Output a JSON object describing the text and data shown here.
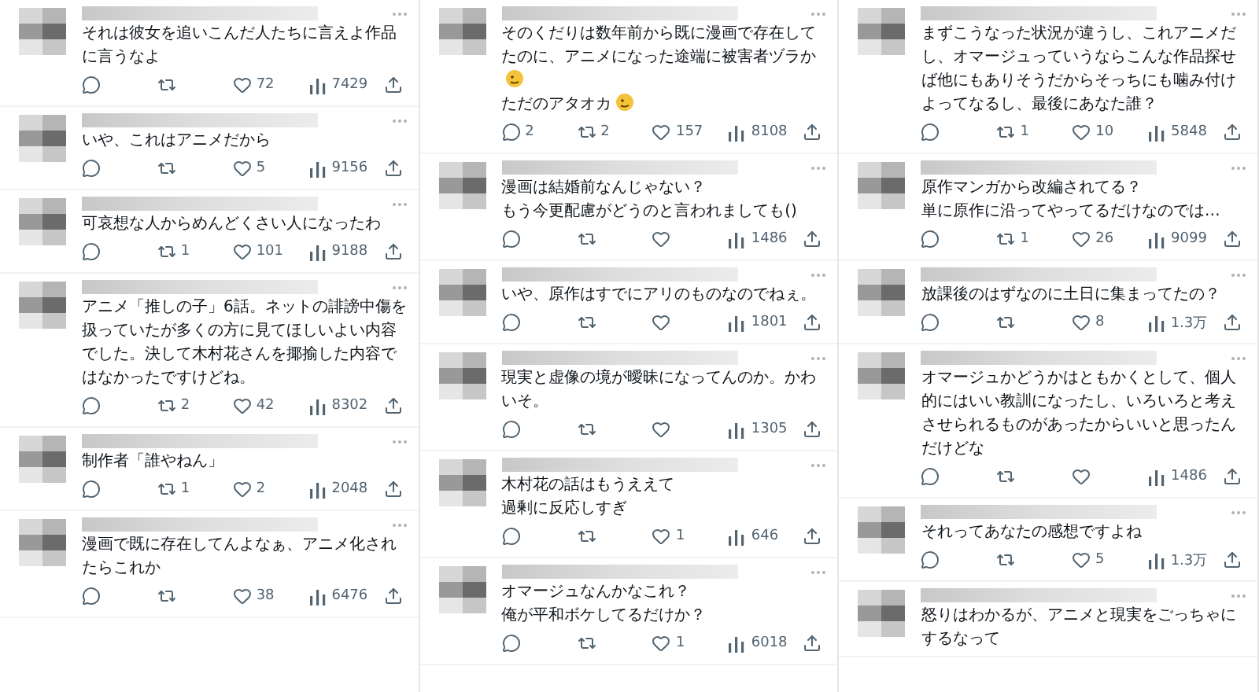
{
  "columns": [
    {
      "replies": [
        {
          "paragraphs": [
            {
              "kind": "plain",
              "text": "それは彼女を追いこんだ人たちに言えよ作品に言うなよ"
            }
          ],
          "stats": {
            "likes": "72",
            "views": "7429"
          }
        },
        {
          "paragraphs": [
            {
              "kind": "plain",
              "text": "いや、これはアニメだから"
            }
          ],
          "stats": {
            "likes": "5",
            "views": "9156"
          }
        },
        {
          "paragraphs": [
            {
              "kind": "plain",
              "text": "可哀想な人からめんどくさい人になったわ"
            }
          ],
          "stats": {
            "reposts": "1",
            "likes": "101",
            "views": "9188"
          }
        },
        {
          "paragraphs": [
            {
              "kind": "plain",
              "text": "アニメ「推しの子」6話。ネットの誹謗中傷を扱っていたが多くの方に見てほしいよい内容でした。決して木村花さんを揶揄した内容ではなかったですけどね。"
            }
          ],
          "stats": {
            "reposts": "2",
            "likes": "42",
            "views": "8302"
          }
        },
        {
          "paragraphs": [
            {
              "kind": "plain",
              "text": "制作者「誰やねん」"
            }
          ],
          "stats": {
            "reposts": "1",
            "likes": "2",
            "views": "2048"
          }
        },
        {
          "paragraphs": [
            {
              "kind": "plain",
              "text": "漫画で既に存在してんよなぁ、アニメ化されたらこれか"
            }
          ],
          "stats": {
            "likes": "38",
            "views": "6476"
          }
        }
      ]
    },
    {
      "replies": [
        {
          "paragraphs": [
            {
              "kind": "emoji",
              "text": "そのくだりは数年前から既に漫画で存在してたのに、アニメになった途端に被害者ヅラか"
            },
            {
              "kind": "emoji",
              "text": "ただのアタオカ"
            }
          ],
          "stats": {
            "replies": "2",
            "reposts": "2",
            "likes": "157",
            "views": "8108"
          }
        },
        {
          "paragraphs": [
            {
              "kind": "plain",
              "text": "漫画は結婚前なんじゃない？"
            },
            {
              "kind": "plain",
              "text": "もう今更配慮がどうのと言われましても()"
            }
          ],
          "stats": {
            "views": "1486"
          }
        },
        {
          "paragraphs": [
            {
              "kind": "plain",
              "text": "いや、原作はすでにアリのものなのでねぇ。"
            }
          ],
          "stats": {
            "views": "1801"
          }
        },
        {
          "paragraphs": [
            {
              "kind": "plain",
              "text": "現実と虚像の境が曖昧になってんのか。かわいそ。"
            }
          ],
          "stats": {
            "views": "1305"
          }
        },
        {
          "paragraphs": [
            {
              "kind": "plain",
              "text": "木村花の話はもうええて"
            },
            {
              "kind": "plain",
              "text": "過剰に反応しすぎ"
            }
          ],
          "stats": {
            "likes": "1",
            "views": "646"
          }
        },
        {
          "paragraphs": [
            {
              "kind": "plain",
              "text": "オマージュなんかなこれ？"
            },
            {
              "kind": "plain",
              "text": "俺が平和ボケしてるだけか？"
            }
          ],
          "stats": {
            "likes": "1",
            "views": "6018"
          }
        }
      ]
    },
    {
      "replies": [
        {
          "paragraphs": [
            {
              "kind": "plain",
              "text": "まずこうなった状況が違うし、これアニメだし、オマージュっていうならこんな作品探せば他にもありそうだからそっちにも噛み付けよってなるし、最後にあなた誰？"
            }
          ],
          "stats": {
            "reposts": "1",
            "likes": "10",
            "views": "5848"
          }
        },
        {
          "paragraphs": [
            {
              "kind": "plain",
              "text": "原作マンガから改編されてる？"
            },
            {
              "kind": "plain",
              "text": "単に原作に沿ってやってるだけなのでは…"
            }
          ],
          "stats": {
            "reposts": "1",
            "likes": "26",
            "views": "9099"
          }
        },
        {
          "paragraphs": [
            {
              "kind": "plain",
              "text": "放課後のはずなのに土日に集まってたの？"
            }
          ],
          "stats": {
            "likes": "8",
            "views": "1.3万"
          }
        },
        {
          "paragraphs": [
            {
              "kind": "plain",
              "text": "オマージュかどうかはともかくとして、個人的にはいい教訓になったし、いろいろと考えさせられるものがあったからいいと思ったんだけどな"
            }
          ],
          "stats": {
            "views": "1486"
          }
        },
        {
          "paragraphs": [
            {
              "kind": "plain",
              "text": "それってあなたの感想ですよね"
            }
          ],
          "stats": {
            "likes": "5",
            "views": "1.3万"
          }
        },
        {
          "paragraphs": [
            {
              "kind": "plain",
              "text": "怒りはわかるが、アニメと現実をごっちゃにするなって"
            }
          ]
        }
      ]
    }
  ]
}
